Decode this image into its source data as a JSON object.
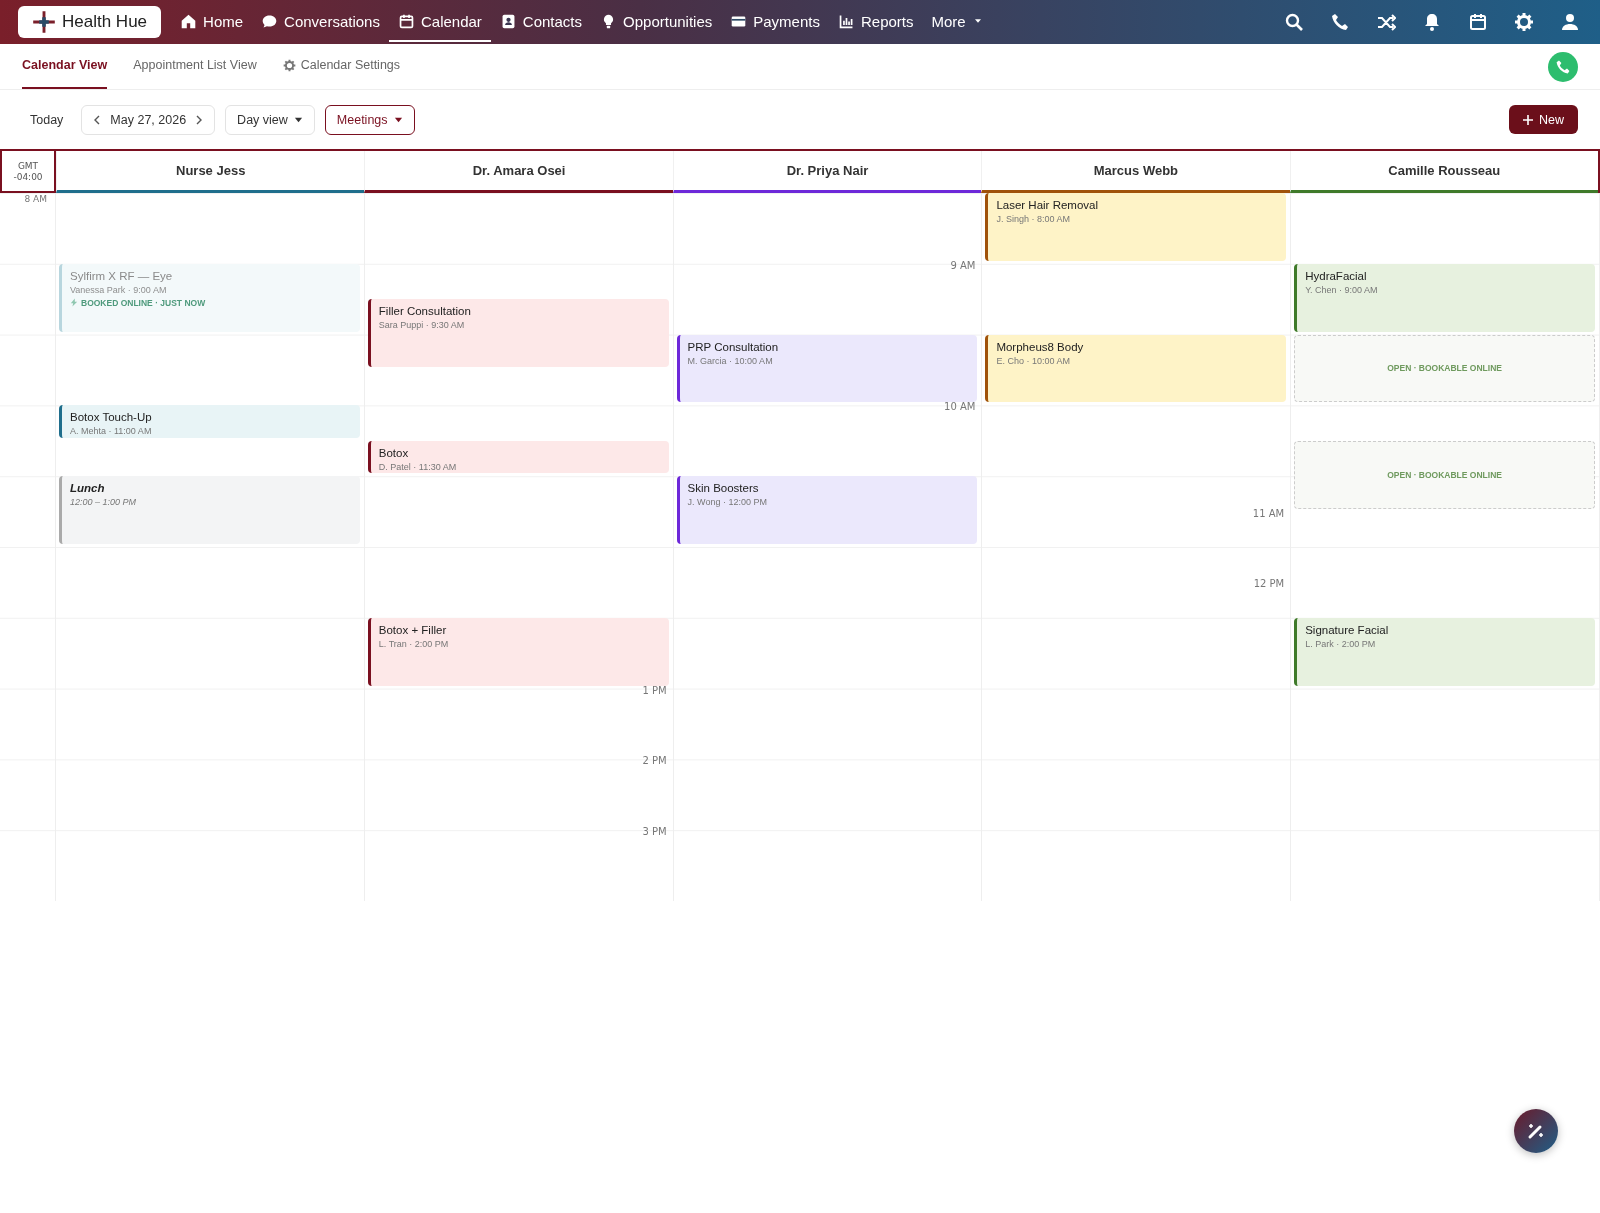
{
  "brand": {
    "name": "Health Hue"
  },
  "nav": [
    {
      "label": "Home",
      "selected": false
    },
    {
      "label": "Conversations",
      "selected": false
    },
    {
      "label": "Calendar",
      "selected": true
    },
    {
      "label": "Contacts",
      "selected": false
    },
    {
      "label": "Opportunities",
      "selected": false
    },
    {
      "label": "Payments",
      "selected": false
    },
    {
      "label": "Reports",
      "selected": false
    },
    {
      "label": "More",
      "selected": false
    }
  ],
  "subtabs": [
    {
      "label": "Calendar View",
      "selected": true
    },
    {
      "label": "Appointment List View",
      "selected": false
    },
    {
      "label": "Calendar Settings",
      "selected": false
    }
  ],
  "toolbar": {
    "today": "Today",
    "date": "May 27, 2026",
    "view": "Day view",
    "filter": "Meetings",
    "new_button": "New"
  },
  "timezone": [
    "GMT",
    "-04:00"
  ],
  "gutter_marks": [
    {
      "label": "8 AM"
    }
  ],
  "columns": [
    {
      "name": "Nurse Jess",
      "color": "#1f6e8c",
      "events": [
        {
          "kind": "pending",
          "title": "Sylfirm X RF — Eye",
          "detail": "Vanessa Park · 9:00 AM",
          "note": "BOOKED ONLINE · JUST NOW"
        },
        {
          "kind": "appointment",
          "title": "Botox Touch-Up",
          "detail": "A. Mehta · 11:00 AM"
        },
        {
          "kind": "break",
          "title": "Lunch",
          "detail": "12:00 – 1:00 PM"
        }
      ]
    },
    {
      "name": "Dr. Amara Osei",
      "color": "#7a1020",
      "time_marks": [
        {
          "label": "1 PM"
        },
        {
          "label": "2 PM"
        },
        {
          "label": "3 PM"
        }
      ],
      "events": [
        {
          "kind": "appointment",
          "title": "Filler Consultation",
          "detail": "Sara Puppi · 9:30 AM"
        },
        {
          "kind": "appointment",
          "title": "Botox",
          "detail": "D. Patel · 11:30 AM"
        },
        {
          "kind": "appointment",
          "title": "Botox + Filler",
          "detail": "L. Tran · 2:00 PM"
        }
      ]
    },
    {
      "name": "Dr. Priya Nair",
      "color": "#6d28d9",
      "time_marks": [
        {
          "label": "9 AM"
        },
        {
          "label": "10 AM"
        }
      ],
      "events": [
        {
          "kind": "appointment",
          "title": "PRP Consultation",
          "detail": "M. Garcia · 10:00 AM"
        },
        {
          "kind": "appointment",
          "title": "Skin Boosters",
          "detail": "J. Wong · 12:00 PM"
        }
      ]
    },
    {
      "name": "Marcus Webb",
      "color": "#a0520a",
      "time_marks": [
        {
          "label": "11 AM"
        },
        {
          "label": "12 PM"
        }
      ],
      "events": [
        {
          "kind": "appointment",
          "title": "Laser Hair Removal",
          "detail": "J. Singh · 8:00 AM"
        },
        {
          "kind": "appointment",
          "title": "Morpheus8 Body",
          "detail": "E. Cho · 10:00 AM"
        }
      ]
    },
    {
      "name": "Camille Rousseau",
      "color": "#3f7a2a",
      "events": [
        {
          "kind": "appointment",
          "title": "HydraFacial",
          "detail": "Y. Chen · 9:00 AM"
        },
        {
          "kind": "open",
          "title": "OPEN · BOOKABLE ONLINE"
        },
        {
          "kind": "open",
          "title": "OPEN · BOOKABLE ONLINE"
        },
        {
          "kind": "appointment",
          "title": "Signature Facial",
          "detail": "L. Park · 2:00 PM"
        }
      ]
    }
  ]
}
